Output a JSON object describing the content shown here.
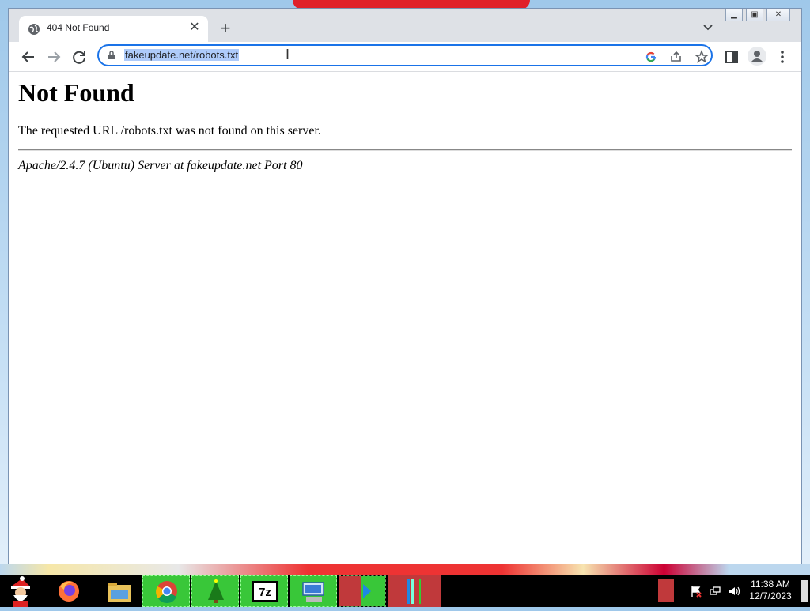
{
  "browser": {
    "tab_title": "404 Not Found",
    "url": "fakeupdate.net/robots.txt"
  },
  "page": {
    "heading": "Not Found",
    "message": "The requested URL /robots.txt was not found on this server.",
    "server_signature": "Apache/2.4.7 (Ubuntu) Server at fakeupdate.net Port 80"
  },
  "taskbar": {
    "time": "11:38 AM",
    "date": "12/7/2023",
    "apps": [
      "santa-start",
      "firefox",
      "file-explorer",
      "chrome",
      "tree-app",
      "7zip",
      "keyboard-app",
      "media-app",
      "misc-app"
    ]
  },
  "colors": {
    "accent": "#1a73e8",
    "selection": "#aecbfa",
    "taskbar_active": "#39c739"
  }
}
